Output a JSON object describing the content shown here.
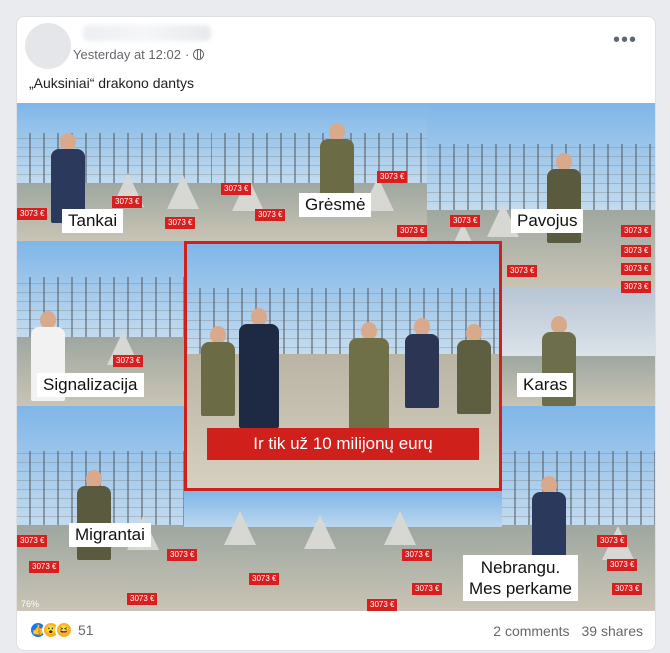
{
  "post": {
    "time": "Yesterday at 12:02",
    "caption": "„Auksiniai“ drakono dantys"
  },
  "image": {
    "labels": {
      "tankai": "Tankai",
      "gresme": "Grėsmė",
      "pavojus": "Pavojus",
      "signalizacija": "Signalizacija",
      "karas": "Karas",
      "migrantai": "Migrantai",
      "nebrangu": "Nebrangu.",
      "mes_perkame": "Mes perkame",
      "banner": "Ir tik už 10 milijonų eurų"
    },
    "price_tag": "3073 €",
    "zoom_hint": "76%"
  },
  "footer": {
    "reaction_count": "51",
    "comments": "2 comments",
    "shares": "39 shares"
  },
  "colors": {
    "accent_red": "#d0201c",
    "like_blue": "#1877f2",
    "haha_yellow": "#f7b125"
  },
  "icons": {
    "more": "more-horizontal-icon",
    "privacy": "globe-icon",
    "reactions": [
      "like-icon",
      "wow-icon",
      "haha-icon"
    ]
  }
}
